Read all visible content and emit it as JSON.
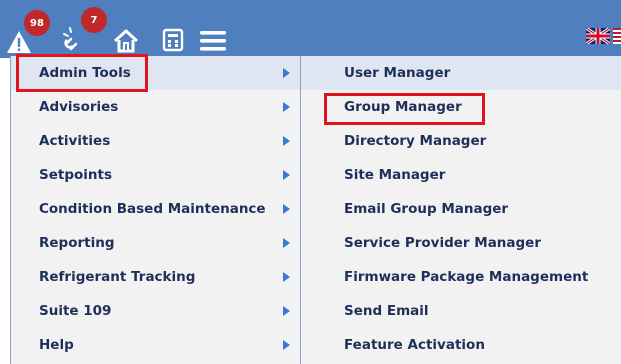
{
  "toolbar": {
    "alerts_icon": "warning-icon",
    "alerts_badge": "98",
    "links_icon": "broken-link-icon",
    "links_badge": "7",
    "home_icon": "home-icon",
    "report_icon": "calculator-icon",
    "menu_icon": "hamburger-menu-icon",
    "language_flags": [
      "uk-flag-icon",
      "us-flag-icon"
    ]
  },
  "main_menu": {
    "items": [
      {
        "label": "Admin Tools",
        "has_submenu": true,
        "highlighted": true
      },
      {
        "label": "Advisories",
        "has_submenu": true
      },
      {
        "label": "Activities",
        "has_submenu": true
      },
      {
        "label": "Setpoints",
        "has_submenu": true
      },
      {
        "label": "Condition Based Maintenance",
        "has_submenu": true
      },
      {
        "label": "Reporting",
        "has_submenu": true
      },
      {
        "label": "Refrigerant Tracking",
        "has_submenu": true
      },
      {
        "label": "Suite 109",
        "has_submenu": true
      },
      {
        "label": "Help",
        "has_submenu": true
      }
    ]
  },
  "submenu": {
    "items": [
      {
        "label": "User Manager"
      },
      {
        "label": "Group Manager",
        "highlighted": true
      },
      {
        "label": "Directory Manager"
      },
      {
        "label": "Site Manager"
      },
      {
        "label": "Email Group Manager"
      },
      {
        "label": "Service Provider Manager"
      },
      {
        "label": "Firmware Package Management"
      },
      {
        "label": "Send Email"
      },
      {
        "label": "Feature Activation"
      }
    ]
  },
  "colors": {
    "topbar": "#4f7fbe",
    "badge": "#c0282a",
    "menu_bg": "#f2f2f2",
    "menu_text": "#1e2f5a",
    "arrow": "#3b7ad0",
    "highlight_box": "#e0141e"
  }
}
